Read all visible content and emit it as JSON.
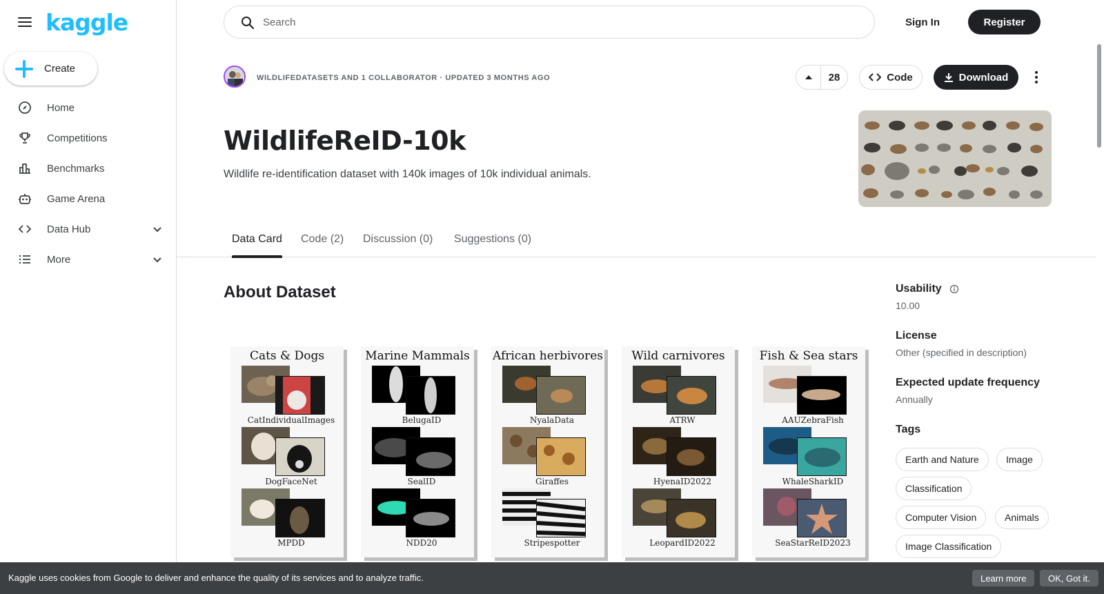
{
  "sidebar": {
    "logo": "kaggle",
    "create_label": "Create",
    "items": [
      {
        "label": "Home",
        "icon": "compass-icon"
      },
      {
        "label": "Competitions",
        "icon": "trophy-icon"
      },
      {
        "label": "Benchmarks",
        "icon": "bar-chart-icon"
      },
      {
        "label": "Game Arena",
        "icon": "robot-icon"
      },
      {
        "label": "Data Hub",
        "icon": "code-icon",
        "expandable": true
      },
      {
        "label": "More",
        "icon": "list-icon",
        "expandable": true
      }
    ]
  },
  "header": {
    "search_placeholder": "Search",
    "sign_in": "Sign In",
    "register": "Register"
  },
  "dataset": {
    "owner_line": "WILDLIFEDATASETS AND 1 COLLABORATOR · UPDATED 3 MONTHS AGO",
    "upvotes": "28",
    "code_label": "Code",
    "download_label": "Download",
    "title": "WildlifeReID-10k",
    "subtitle": "Wildlife re-identification dataset with 140k images of 10k individual animals."
  },
  "tabs": [
    {
      "label": "Data Card",
      "active": true
    },
    {
      "label": "Code (2)",
      "active": false
    },
    {
      "label": "Discussion (0)",
      "active": false
    },
    {
      "label": "Suggestions (0)",
      "active": false
    }
  ],
  "about_heading": "About Dataset",
  "figure": {
    "panels": [
      {
        "title": "Cats & Dogs",
        "datasets": [
          "CatIndividualImages",
          "DogFaceNet",
          "MPDD"
        ]
      },
      {
        "title": "Marine Mammals",
        "datasets": [
          "BelugaID",
          "SealID",
          "NDD20"
        ]
      },
      {
        "title": "African herbivores",
        "datasets": [
          "NyalaData",
          "Giraffes",
          "Stripespotter"
        ]
      },
      {
        "title": "Wild carnivores",
        "datasets": [
          "ATRW",
          "HyenaID2022",
          "LeopardID2022"
        ]
      },
      {
        "title": "Fish & Sea stars",
        "datasets": [
          "AAUZebraFish",
          "WhaleSharkID",
          "SeaStarReID2023"
        ]
      }
    ]
  },
  "info": {
    "usability_label": "Usability",
    "usability_value": "10.00",
    "license_label": "License",
    "license_value": "Other (specified in description)",
    "frequency_label": "Expected update frequency",
    "frequency_value": "Annually",
    "tags_label": "Tags",
    "tags": [
      "Earth and Nature",
      "Image",
      "Classification",
      "Computer Vision",
      "Animals",
      "Image Classification"
    ]
  },
  "cookie": {
    "text": "Kaggle uses cookies from Google to deliver and enhance the quality of its services and to analyze traffic.",
    "learn_more": "Learn more",
    "ok": "OK, Got it."
  },
  "colors": {
    "brand": "#20beff",
    "primary_button": "#202124",
    "border": "#dadce0",
    "cookie_bg": "#3c4043"
  }
}
